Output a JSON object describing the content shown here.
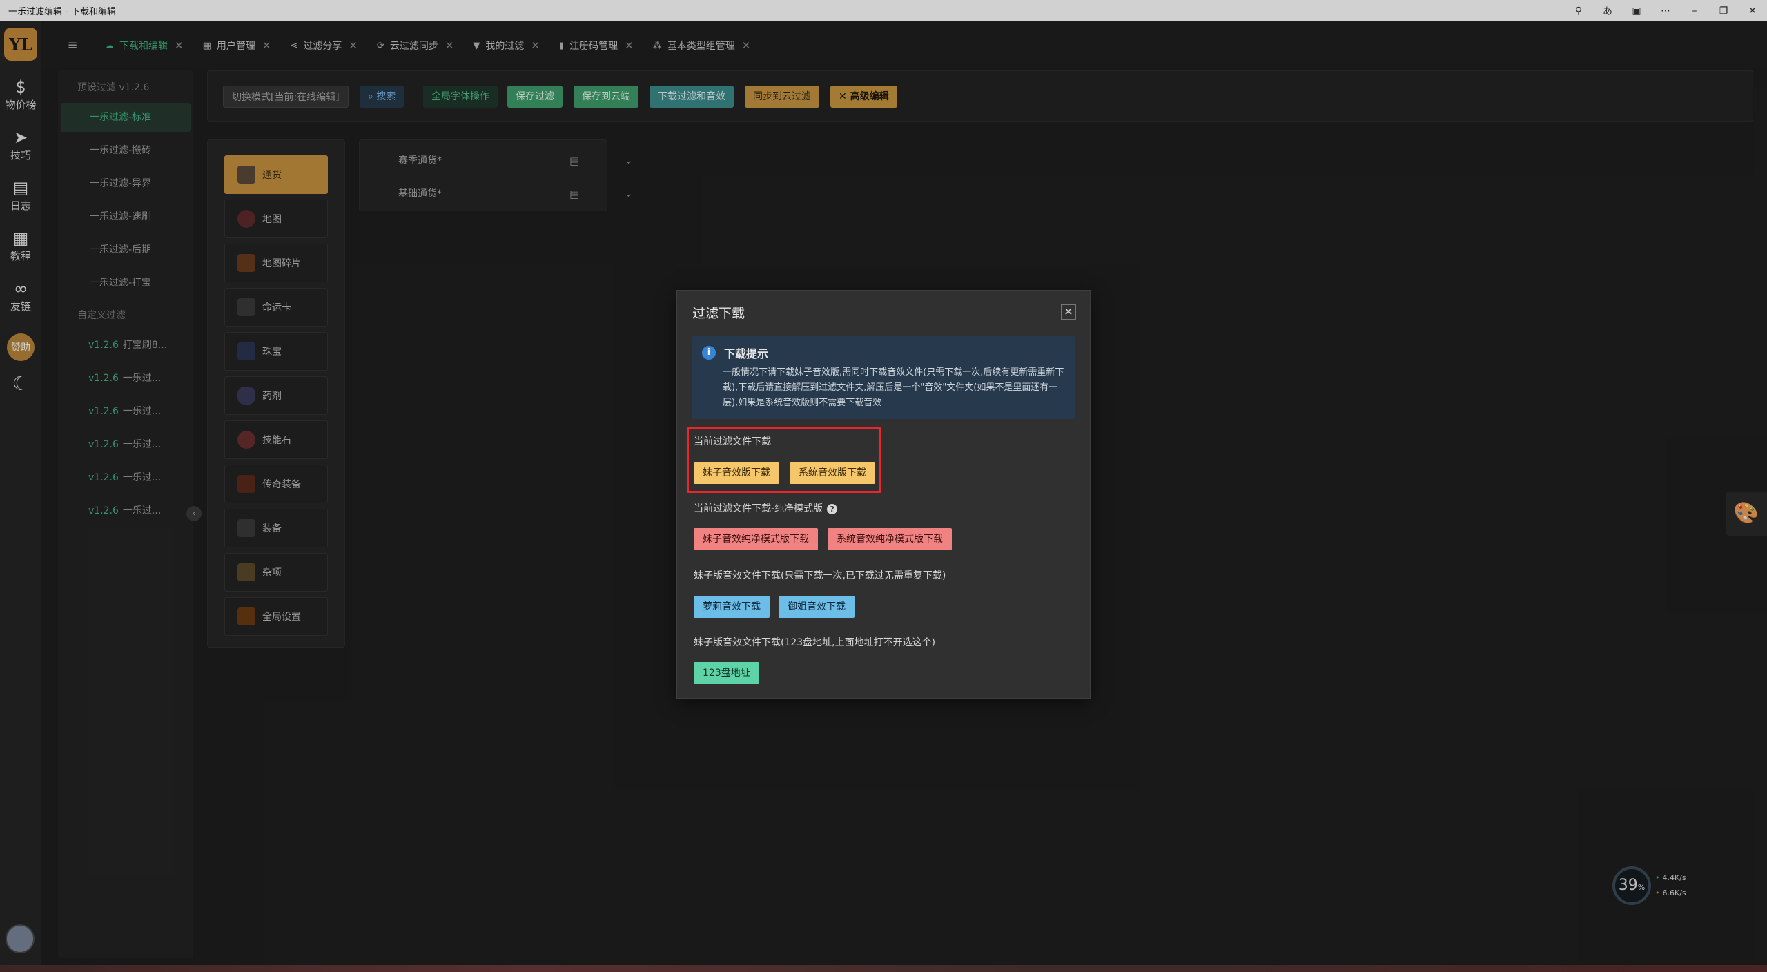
{
  "window": {
    "title": "一乐过滤编辑 - 下载和编辑"
  },
  "rail": {
    "logo": "YL",
    "items": [
      {
        "label": "物价榜",
        "icon": "money-bag-icon"
      },
      {
        "label": "技巧",
        "icon": "send-icon"
      },
      {
        "label": "日志",
        "icon": "log-icon"
      },
      {
        "label": "教程",
        "icon": "document-icon"
      },
      {
        "label": "友链",
        "icon": "link-icon"
      }
    ],
    "sponsor": "赞助"
  },
  "tabs": [
    {
      "label": "下载和编辑",
      "icon": "cloud-icon",
      "active": true
    },
    {
      "label": "用户管理",
      "icon": "grid-icon",
      "active": false
    },
    {
      "label": "过滤分享",
      "icon": "share-icon",
      "active": false
    },
    {
      "label": "云过滤同步",
      "icon": "sync-icon",
      "active": false
    },
    {
      "label": "我的过滤",
      "icon": "filter-icon",
      "active": false
    },
    {
      "label": "注册码管理",
      "icon": "card-icon",
      "active": false
    },
    {
      "label": "基本类型组管理",
      "icon": "shapes-icon",
      "active": false
    }
  ],
  "filter_panel": {
    "preset_group": "预设过滤 v1.2.6",
    "presets": [
      "一乐过滤-标准",
      "一乐过滤-搬砖",
      "一乐过滤-异界",
      "一乐过滤-速刷",
      "一乐过滤-后期",
      "一乐过滤-打宝"
    ],
    "custom_group": "自定义过滤",
    "custom": [
      {
        "version": "v1.2.6",
        "name": "打宝刷8..."
      },
      {
        "version": "v1.2.6",
        "name": "一乐过..."
      },
      {
        "version": "v1.2.6",
        "name": "一乐过..."
      },
      {
        "version": "v1.2.6",
        "name": "一乐过..."
      },
      {
        "version": "v1.2.6",
        "name": "一乐过..."
      },
      {
        "version": "v1.2.6",
        "name": "一乐过..."
      }
    ]
  },
  "toolbar": {
    "mode": "切换模式[当前:在线编辑]",
    "search": "搜索",
    "font_ops": "全局字体操作",
    "save": "保存过滤",
    "save_cloud": "保存到云端",
    "download": "下载过滤和音效",
    "sync_cloud": "同步到云过滤",
    "advanced": "高级编辑"
  },
  "categories": [
    "通货",
    "地图",
    "地图碎片",
    "命运卡",
    "珠宝",
    "药剂",
    "技能石",
    "传奇装备",
    "装备",
    "杂项",
    "全局设置"
  ],
  "currency_panel": {
    "rows": [
      "赛季通货*",
      "基础通货*"
    ]
  },
  "modal": {
    "title": "过滤下载",
    "tip_title": "下载提示",
    "tip_body": "一般情况下请下载妹子音效版,需同时下载音效文件(只需下载一次,后续有更新需重新下载),下载后请直接解压到过滤文件夹,解压后是一个\"音效\"文件夹(如果不是里面还有一层),如果是系统音效版则不需要下载音效",
    "sec1_title": "当前过滤文件下载",
    "btn_girl": "妹子音效版下载",
    "btn_system": "系统音效版下载",
    "sec2_title": "当前过滤文件下载-纯净模式版",
    "btn_girl_pure": "妹子音效纯净模式版下载",
    "btn_system_pure": "系统音效纯净模式版下载",
    "sec3_title": "妹子版音效文件下载(只需下载一次,已下载过无需重复下载)",
    "btn_molly": "萝莉音效下载",
    "btn_sister": "御姐音效下载",
    "sec4_title": "妹子版音效文件下载(123盘地址,上面地址打不开选这个)",
    "btn_123": "123盘地址"
  },
  "gauge": {
    "percent": "39",
    "unit": "%",
    "up": "4.4",
    "down": "6.6",
    "speed_unit": "K/s"
  },
  "colors": {
    "accent_green": "#3fb27f",
    "gold": "#c6903f",
    "highlight_red": "#e8262c"
  }
}
